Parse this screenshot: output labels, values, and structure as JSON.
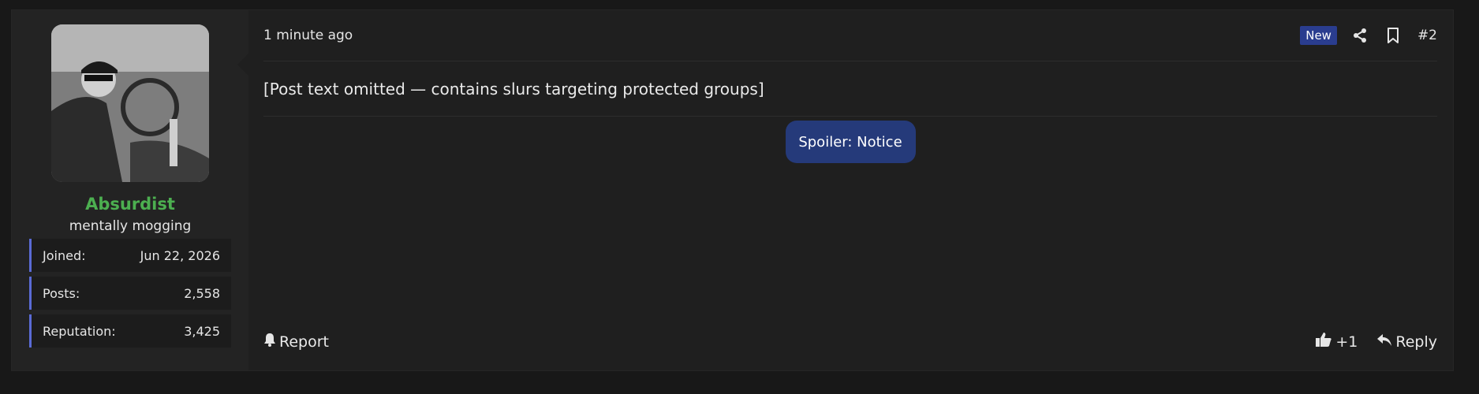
{
  "user": {
    "name": "Absurdist",
    "title": "mentally mogging",
    "stats": [
      {
        "label": "Joined:",
        "value": "Jun 22, 2026"
      },
      {
        "label": "Posts:",
        "value": "2,558"
      },
      {
        "label": "Reputation:",
        "value": "3,425"
      }
    ]
  },
  "post": {
    "time": "1 minute ago",
    "badge": "New",
    "number": "#2",
    "body": "[Post text omitted — contains slurs targeting protected groups]",
    "spoiler_label": "Spoiler: Notice"
  },
  "footer": {
    "report_label": "Report",
    "like_label": "+1",
    "reply_label": "Reply"
  },
  "colors": {
    "username": "#4caf50",
    "accent": "#2a3d8f",
    "stat_border": "#5a6bd6"
  },
  "icons": [
    "share-icon",
    "bookmark-icon",
    "bell-icon",
    "thumbs-up-icon",
    "reply-icon"
  ]
}
